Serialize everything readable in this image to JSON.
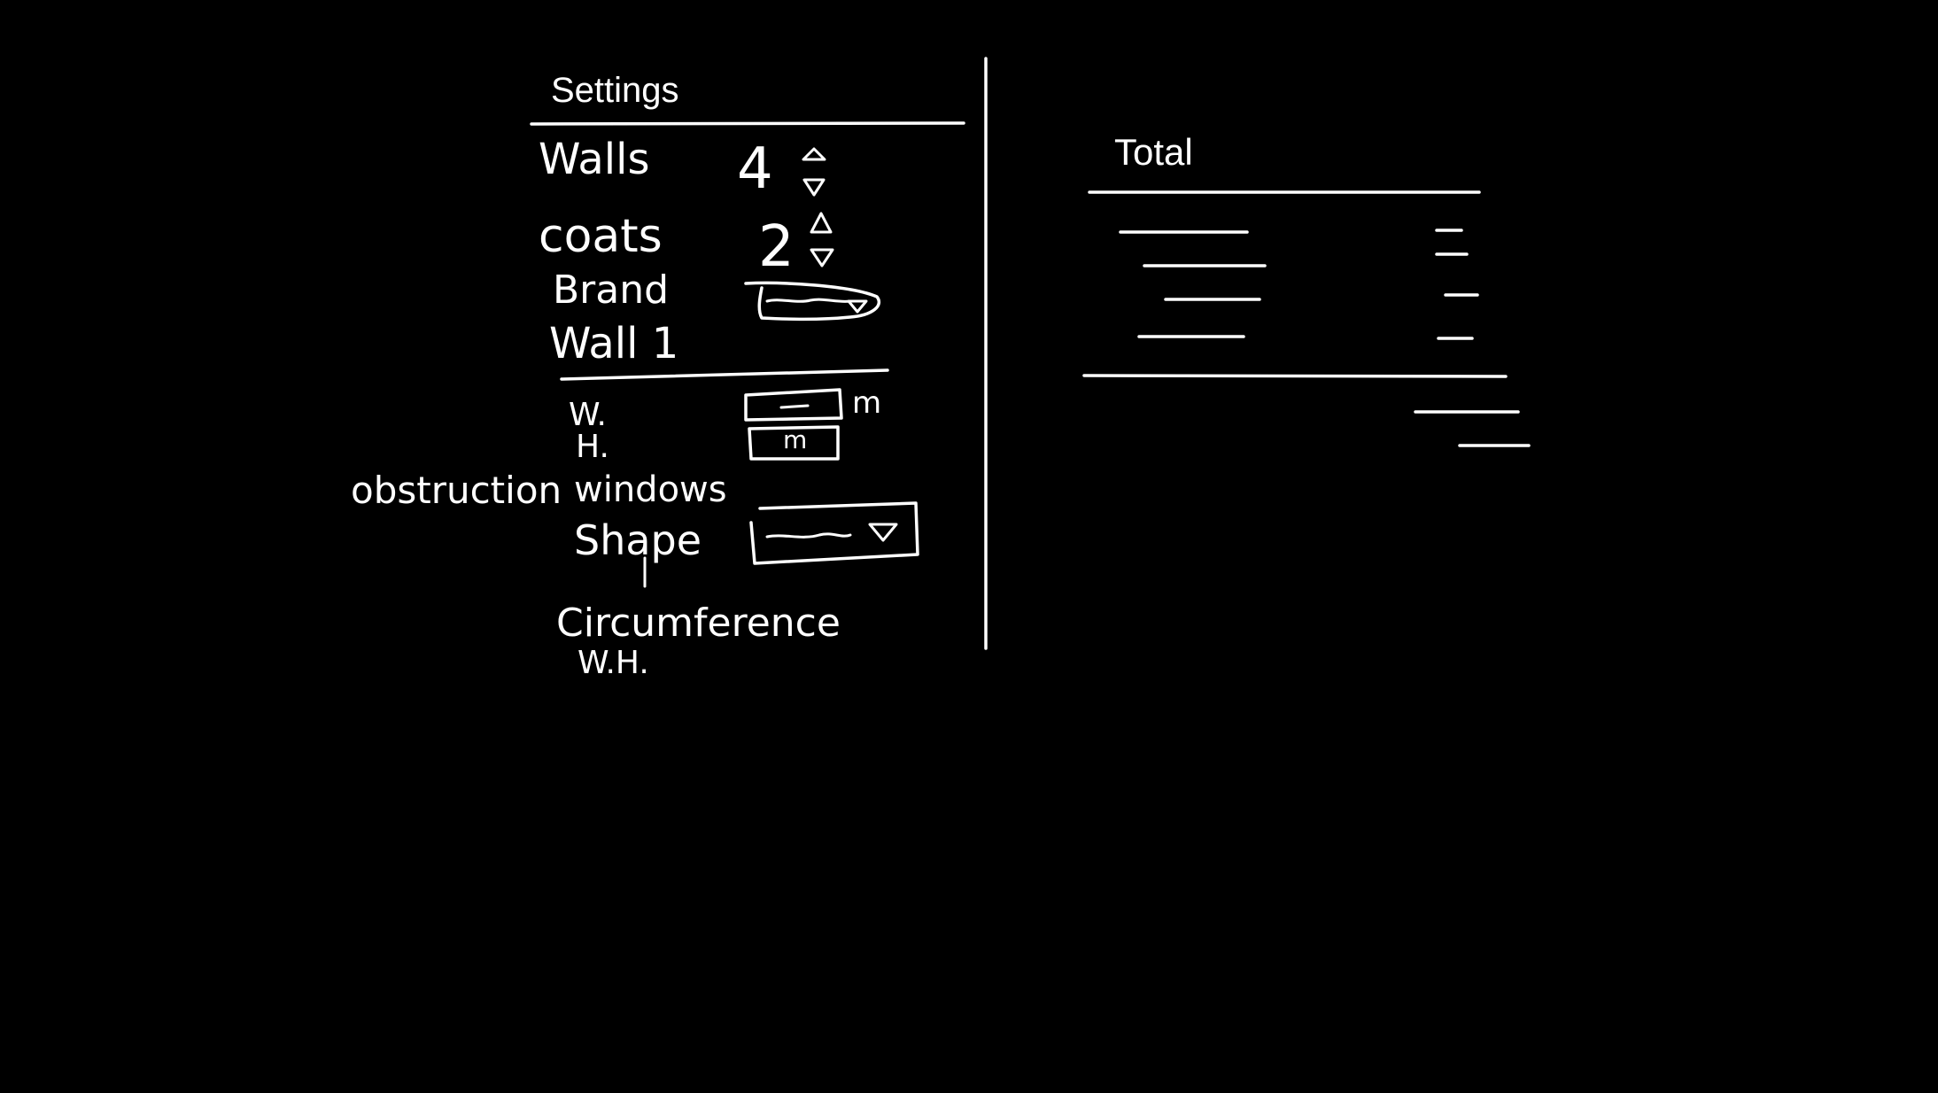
{
  "settings": {
    "title": "Settings",
    "walls_label": "Walls",
    "walls_value": "4",
    "coats_label": "coats",
    "coats_value": "2",
    "brand_label": "Brand",
    "wall_label": "Wall 1",
    "width_label": "W.",
    "width_unit": "m",
    "height_label": "H.",
    "height_unit": "m",
    "obstruction_label": "obstruction",
    "windows_label": "windows",
    "shape_label": "Shape",
    "circumference_label": "Circumference",
    "wh_label": "W.H."
  },
  "total": {
    "title": "Total"
  },
  "colors": {
    "background": "#000000",
    "ink": "#ffffff"
  }
}
